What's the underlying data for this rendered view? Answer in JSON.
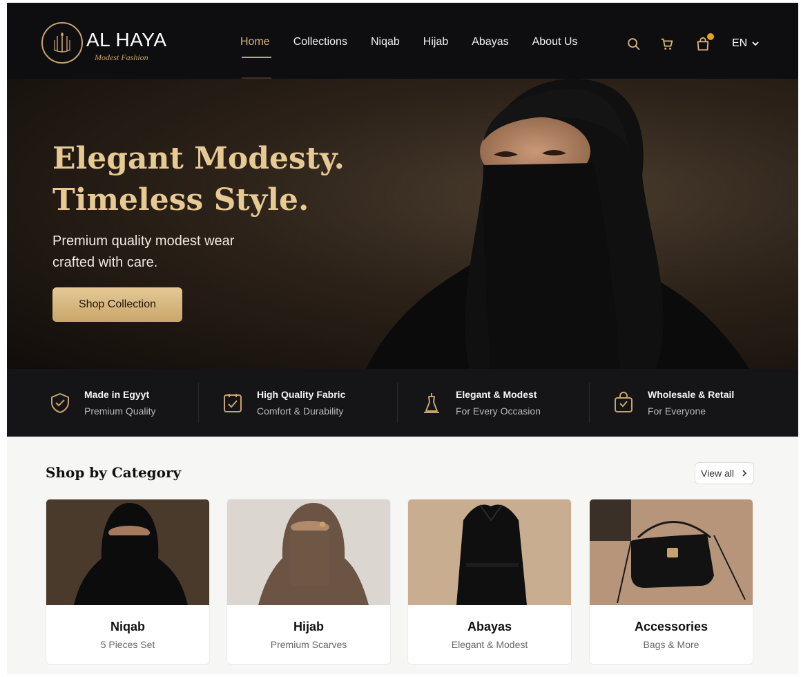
{
  "brand": {
    "name": "AL HAYA",
    "tagline": "Modest Fashion"
  },
  "nav": {
    "items": [
      {
        "label": "Home",
        "active": true
      },
      {
        "label": "Collections"
      },
      {
        "label": "Niqab"
      },
      {
        "label": "Hijab"
      },
      {
        "label": "Abayas"
      },
      {
        "label": "About Us"
      }
    ]
  },
  "header_icons": [
    "search-icon",
    "cart-icon",
    "bag-icon"
  ],
  "language": {
    "selected": "EN"
  },
  "hero": {
    "title_line1": "Elegant Modesty.",
    "title_line2": "Timeless Style.",
    "subtitle": "Premium quality modest wear crafted with care.",
    "cta_label": "Shop Collection"
  },
  "features": [
    {
      "title": "Made in Egyyt",
      "subtitle": "Premium Quality",
      "icon": "shield-check-icon"
    },
    {
      "title": "High Quality Fabric",
      "subtitle": "Comfort & Durability",
      "icon": "fabric-badge-icon"
    },
    {
      "title": "Elegant & Modest",
      "subtitle": "For Every Occasion",
      "icon": "dress-form-icon"
    },
    {
      "title": "Wholesale & Retail",
      "subtitle": "For Everyone",
      "icon": "shopping-bag-icon"
    }
  ],
  "categories_section": {
    "title": "Shop by Category",
    "view_all_label": "View all",
    "items": [
      {
        "title": "Niqab",
        "subtitle": "5 Pieces Set"
      },
      {
        "title": "Hijab",
        "subtitle": "Premium Scarves"
      },
      {
        "title": "Abayas",
        "subtitle": "Elegant & Modest"
      },
      {
        "title": "Accessories",
        "subtitle": "Bags & More"
      }
    ]
  },
  "colors": {
    "accent_gold": "#c7a46d",
    "header_bg": "#0e0e10",
    "features_bg": "#151517"
  }
}
